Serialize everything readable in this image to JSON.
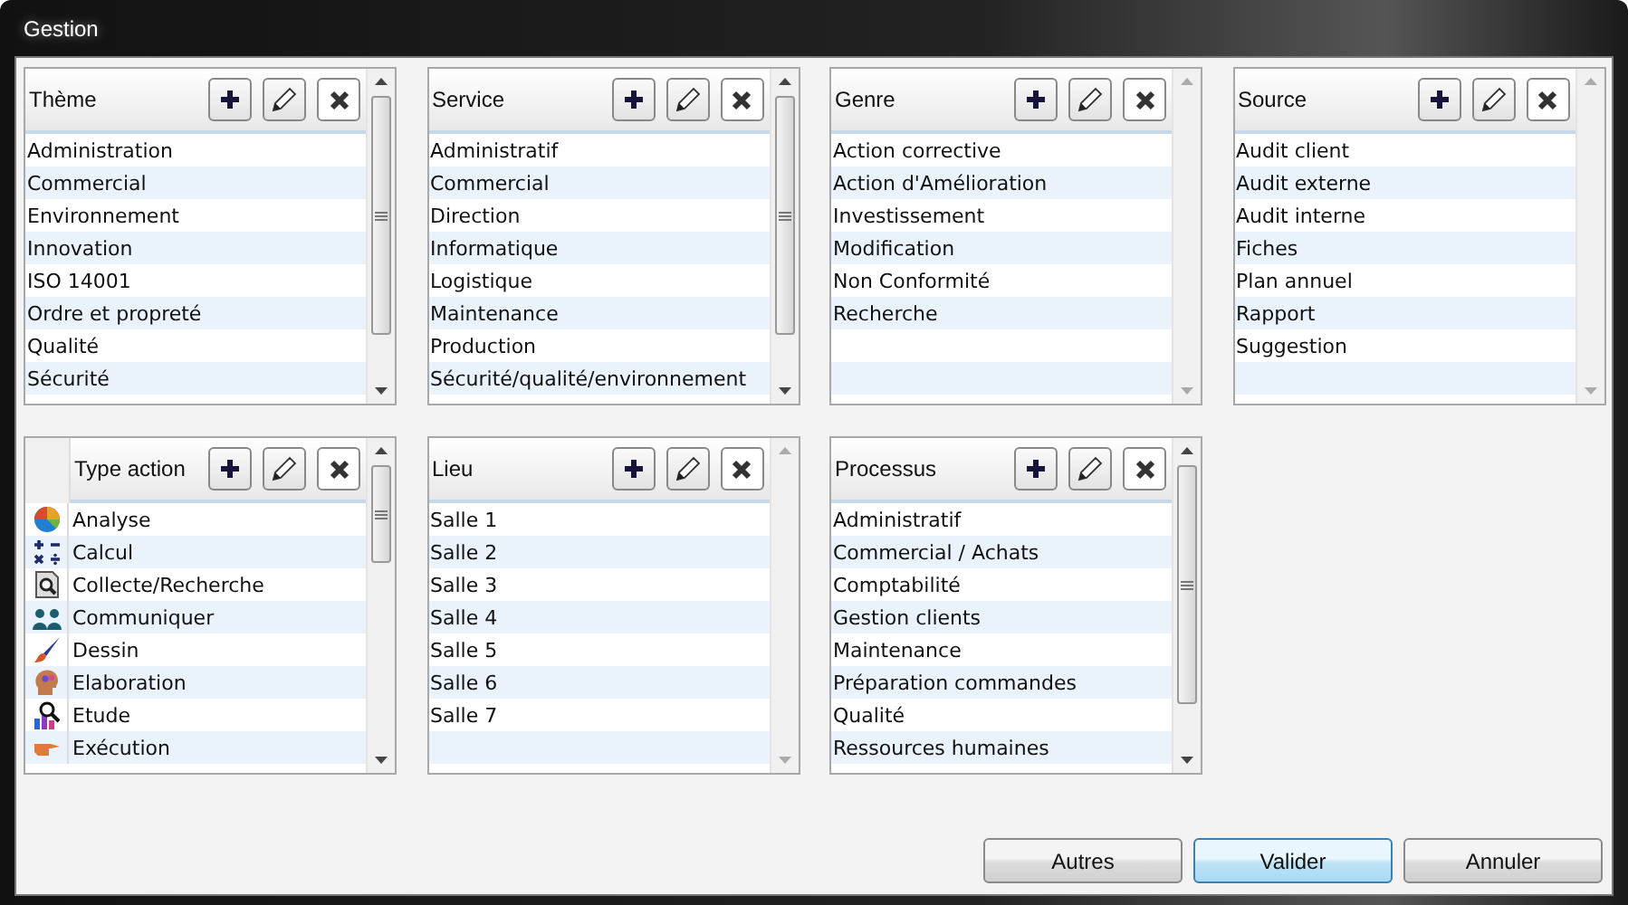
{
  "window": {
    "title": "Gestion"
  },
  "panels": [
    {
      "title": "Thème",
      "kind": "plain",
      "items": [
        "Administration",
        "Commercial",
        "Environnement",
        "Innovation",
        "ISO 14001",
        "Ordre et propreté",
        "Qualité",
        "Sécurité"
      ]
    },
    {
      "title": "Service",
      "kind": "plain",
      "items": [
        "Administratif",
        "Commercial",
        "Direction",
        "Informatique",
        "Logistique",
        "Maintenance",
        "Production",
        "Sécurité/qualité/environnement"
      ]
    },
    {
      "title": "Genre",
      "kind": "plain",
      "items": [
        "Action corrective",
        "Action d'Amélioration",
        "Investissement",
        "Modification",
        "Non Conformité",
        "Recherche"
      ]
    },
    {
      "title": "Source",
      "kind": "plain",
      "items": [
        "Audit client",
        "Audit externe",
        "Audit interne",
        "Fiches",
        "Plan annuel",
        "Rapport",
        "Suggestion"
      ]
    },
    {
      "title": "Type action",
      "kind": "icons",
      "items": [
        "Analyse",
        "Calcul",
        "Collecte/Recherche",
        "Communiquer",
        "Dessin",
        "Elaboration",
        "Etude",
        "Exécution"
      ]
    },
    {
      "title": "Lieu",
      "kind": "plain",
      "items": [
        "Salle 1",
        "Salle 2",
        "Salle 3",
        "Salle 4",
        "Salle 5",
        "Salle 6",
        "Salle 7"
      ]
    },
    {
      "title": "Processus",
      "kind": "plain",
      "items": [
        "Administratif",
        "Commercial / Achats",
        "Comptabilité",
        "Gestion clients",
        "Maintenance",
        "Préparation commandes",
        "Qualité",
        "Ressources humaines"
      ]
    }
  ],
  "buttons": [
    {
      "label": "Autres",
      "default": false
    },
    {
      "label": "Valider",
      "default": true
    },
    {
      "label": "Annuler",
      "default": false
    }
  ]
}
